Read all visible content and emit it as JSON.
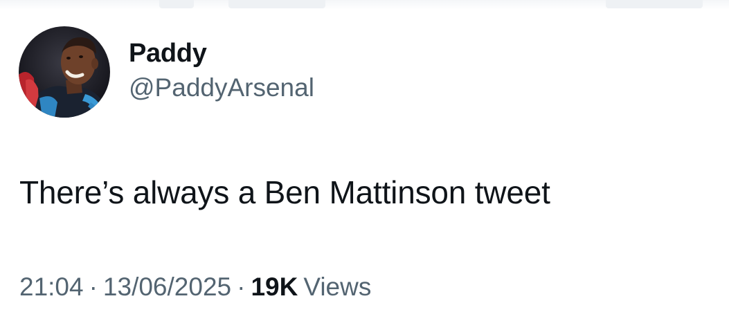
{
  "tweet": {
    "author": {
      "display_name": "Paddy",
      "handle": "@PaddyArsenal",
      "avatar": "profile-photo"
    },
    "text": "There’s always a Ben Mattinson tweet",
    "time": "21:04",
    "date": "13/06/2025",
    "separator": "·",
    "views_count": "19K",
    "views_label": "Views"
  },
  "colors": {
    "primary_text": "#0f1419",
    "secondary_text": "#536471",
    "background": "#ffffff"
  }
}
